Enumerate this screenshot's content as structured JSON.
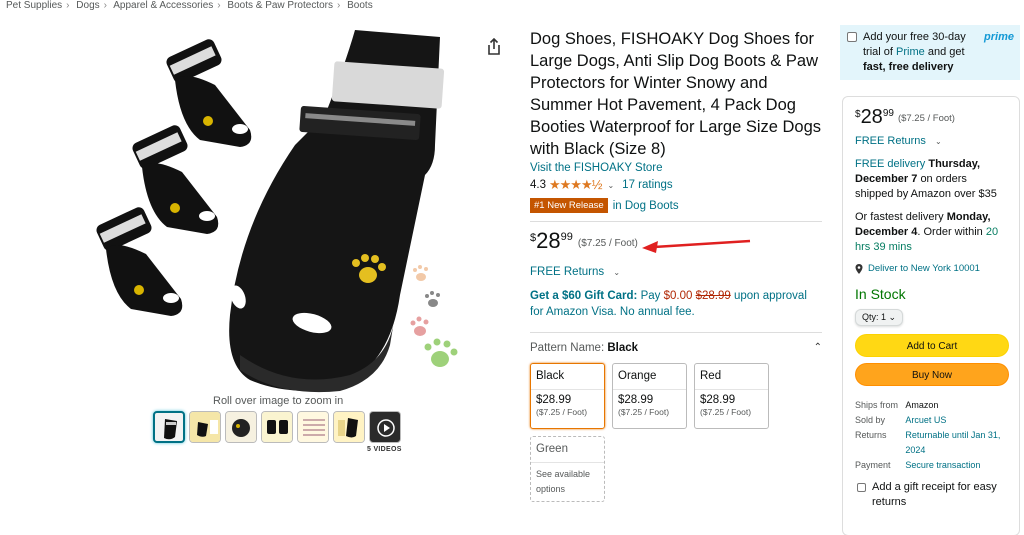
{
  "breadcrumb": [
    "Pet Supplies",
    "Dogs",
    "Apparel & Accessories",
    "Boots & Paw Protectors",
    "Boots"
  ],
  "gallery": {
    "zoom_hint": "Roll over image to zoom in",
    "videos_label": "5 VIDEOS"
  },
  "product": {
    "title": "Dog Shoes, FISHOAKY Dog Shoes for Large Dogs, Anti Slip Dog Boots & Paw Protectors for Winter Snowy and Summer Hot Pavement, 4 Pack Dog Booties Waterproof for Large Size Dogs with Black (Size 8)",
    "store_link": "Visit the FISHOAKY Store",
    "rating": "4.3",
    "stars": "★★★★½",
    "ratings_count": "17 ratings",
    "badge": "#1 New Release",
    "badge_category": "in Dog Boots",
    "price_symbol": "$",
    "price_whole": "28",
    "price_fraction": "99",
    "unit_price": "($7.25 / Foot)",
    "free_returns": "FREE Returns",
    "giftcard": {
      "lead": "Get a $60 Gift Card:",
      "pay": "Pay",
      "new_price": "$0.00",
      "old_price": "$28.99",
      "tail": "upon approval for Amazon Visa. No annual fee."
    },
    "pattern_label": "Pattern Name:",
    "pattern_value": "Black",
    "swatches": [
      {
        "name": "Black",
        "price": "$28.99",
        "unit": "($7.25 / Foot)"
      },
      {
        "name": "Orange",
        "price": "$28.99",
        "unit": "($7.25 / Foot)"
      },
      {
        "name": "Red",
        "price": "$28.99",
        "unit": "($7.25 / Foot)"
      },
      {
        "name": "Green",
        "avail": "See available options"
      }
    ]
  },
  "prime_offer": {
    "text_a": "Add your free 30-day trial of",
    "prime_word": "Prime",
    "text_b": "and get",
    "text_c": "fast, free delivery",
    "logo": "prime"
  },
  "buybox": {
    "price_symbol": "$",
    "price_whole": "28",
    "price_fraction": "99",
    "unit_price": "($7.25 / Foot)",
    "free_returns": "FREE Returns",
    "free_delivery": "FREE delivery",
    "delivery_date": "Thursday, December 7",
    "delivery_tail": "on orders shipped by Amazon over $35",
    "fastest_lead": "Or fastest delivery",
    "fastest_date": "Monday, December 4",
    "order_within": ". Order within",
    "countdown": "20 hrs 39 mins",
    "location": "Deliver to New York 10001",
    "stock": "In Stock",
    "qty": "Qty: 1",
    "add_to_cart": "Add to Cart",
    "buy_now": "Buy Now",
    "details": [
      {
        "k": "Ships from",
        "v": "Amazon"
      },
      {
        "k": "Sold by",
        "v": "Arcuet US"
      },
      {
        "k": "Returns",
        "v": "Returnable until Jan 31, 2024"
      },
      {
        "k": "Payment",
        "v": "Secure transaction"
      }
    ],
    "gift_receipt": "Add a gift receipt for easy returns"
  },
  "colors": {
    "link": "#007185",
    "badge": "#c45500",
    "cart_button": "#ffd814",
    "buy_button": "#ffa41c",
    "in_stock": "#007600",
    "prime_bg": "#e3f5fb",
    "annotation_arrow": "#e02020"
  }
}
